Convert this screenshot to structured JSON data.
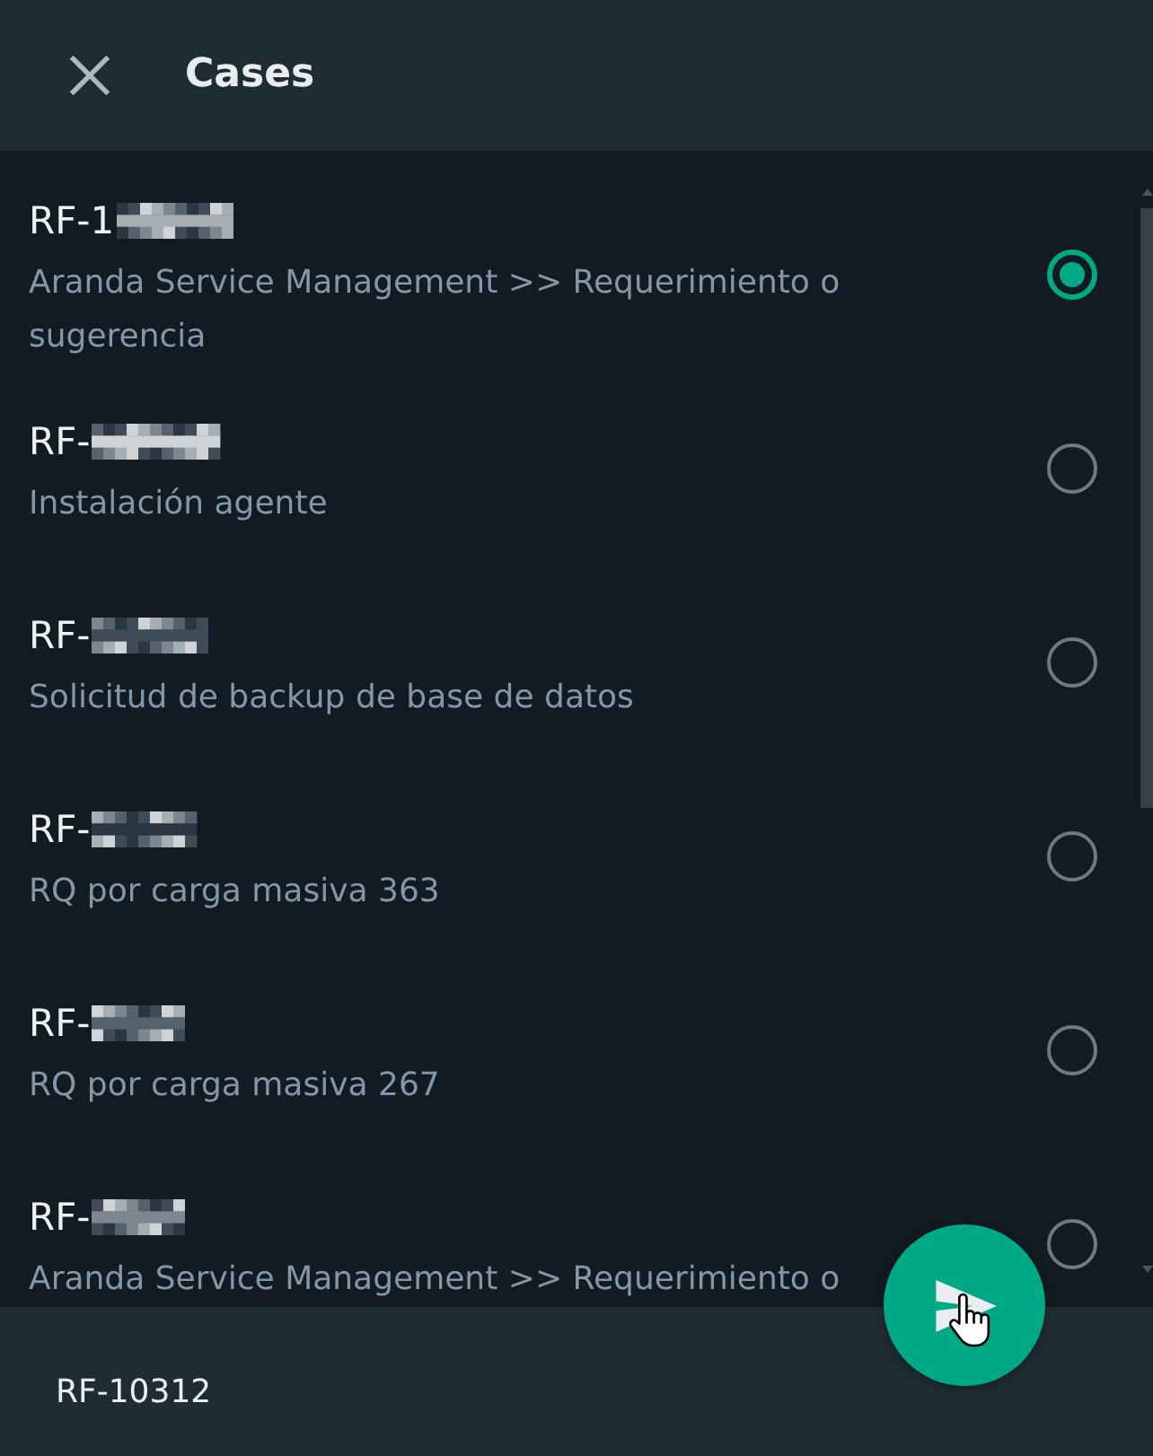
{
  "header": {
    "title": "Cases"
  },
  "cases": [
    {
      "id": "RF-1",
      "description": "Aranda Service Management >> Requerimiento o sugerencia",
      "selected": true
    },
    {
      "id": "RF-",
      "description": "Instalación agente",
      "selected": false
    },
    {
      "id": "RF-",
      "description": "Solicitud de backup de base de datos",
      "selected": false
    },
    {
      "id": "RF-",
      "description": "RQ por carga masiva 363",
      "selected": false
    },
    {
      "id": "RF-",
      "description": "RQ por carga masiva 267",
      "selected": false
    },
    {
      "id": "RF-",
      "description": "Aranda Service Management >> Requerimiento o",
      "selected": false
    }
  ],
  "footer": {
    "selected_case": "RF-10312"
  }
}
